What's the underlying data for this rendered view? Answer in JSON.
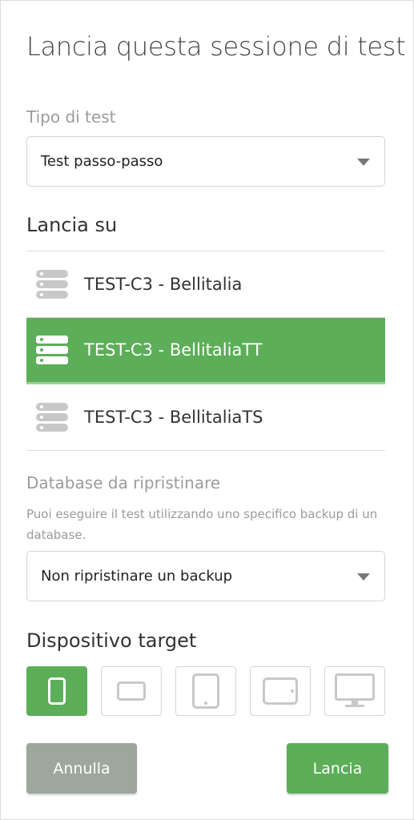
{
  "title": "Lancia questa sessione di test",
  "test_type": {
    "label": "Tipo di test",
    "selected": "Test passo-passo"
  },
  "launch_on": {
    "label": "Lancia su",
    "servers": [
      {
        "name": "TEST-C3 - Bellitalia",
        "active": false
      },
      {
        "name": "TEST-C3 - BellitaliaTT",
        "active": true
      },
      {
        "name": "TEST-C3 - BellitaliaTS",
        "active": false
      }
    ]
  },
  "database": {
    "label": "Database da ripristinare",
    "hint": "Puoi eseguire il test utilizzando uno specifico backup di un database.",
    "selected": "Non ripristinare un backup"
  },
  "device": {
    "label": "Dispositivo target",
    "options": [
      {
        "icon": "phone-portrait-icon",
        "active": true
      },
      {
        "icon": "phone-landscape-icon",
        "active": false
      },
      {
        "icon": "tablet-portrait-icon",
        "active": false
      },
      {
        "icon": "tablet-landscape-icon",
        "active": false
      },
      {
        "icon": "desktop-monitor-icon",
        "active": false
      }
    ]
  },
  "actions": {
    "cancel_label": "Annulla",
    "launch_label": "Lancia"
  },
  "colors": {
    "accent": "#5cae58",
    "muted_button": "#9da79c",
    "muted_text": "#9b9b9b"
  }
}
